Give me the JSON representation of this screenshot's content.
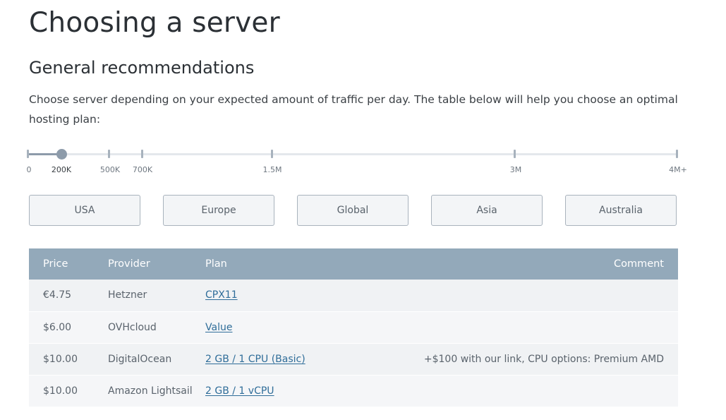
{
  "page": {
    "title": "Choosing a server",
    "section_title": "General recommendations",
    "intro": "Choose server depending on your expected amount of traffic per day. The table below will help you choose an optimal hosting plan:"
  },
  "traffic_slider": {
    "labels": [
      "0",
      "200K",
      "500K",
      "700K",
      "1.5M",
      "3M",
      "4M+"
    ],
    "selected": "200K"
  },
  "regions": {
    "usa": "USA",
    "europe": "Europe",
    "global": "Global",
    "asia": "Asia",
    "australia": "Australia"
  },
  "table": {
    "headers": {
      "price": "Price",
      "provider": "Provider",
      "plan": "Plan",
      "comment": "Comment"
    },
    "rows": [
      {
        "price": "€4.75",
        "provider": "Hetzner",
        "plan": "CPX11",
        "comment": ""
      },
      {
        "price": "$6.00",
        "provider": "OVHcloud",
        "plan": "Value",
        "comment": ""
      },
      {
        "price": "$10.00",
        "provider": "DigitalOcean",
        "plan": "2 GB / 1 CPU (Basic)",
        "comment": "+$100 with our link, CPU options: Premium AMD"
      },
      {
        "price": "$10.00",
        "provider": "Amazon Lightsail",
        "plan": "2 GB / 1 vCPU",
        "comment": ""
      }
    ]
  },
  "colors": {
    "table_header": "#93a9ba",
    "link": "#2f6d99",
    "slider_fill": "#8d9baa"
  }
}
